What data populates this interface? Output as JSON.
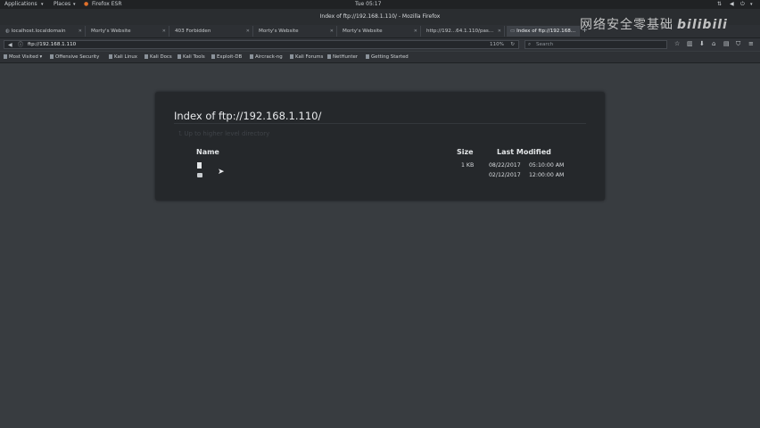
{
  "gnome_bar": {
    "applications": "Applications",
    "places": "Places",
    "firefox": "Firefox ESR",
    "clock": "Tue 05:17"
  },
  "window": {
    "title": "Index of ftp://192.168.1.110/ - Mozilla Firefox"
  },
  "tabs": [
    {
      "label": "localhost.localdomain"
    },
    {
      "label": "Morty's Website"
    },
    {
      "label": "403 Forbidden"
    },
    {
      "label": "Morty's Website"
    },
    {
      "label": "Morty's Website"
    },
    {
      "label": "http://192...64.1.110/pas..."
    },
    {
      "label": "Index of ftp://192.168..."
    }
  ],
  "toolbar": {
    "url": "ftp://192.168.1.110",
    "zoom": "110%",
    "search_placeholder": "Search"
  },
  "bookmarks": [
    {
      "label": "Most Visited"
    },
    {
      "label": "Offensive Security"
    },
    {
      "label": "Kali Linux"
    },
    {
      "label": "Kali Docs"
    },
    {
      "label": "Kali Tools"
    },
    {
      "label": "Exploit-DB"
    },
    {
      "label": "Aircrack-ng"
    },
    {
      "label": "Kali Forums"
    },
    {
      "label": "NetHunter"
    },
    {
      "label": "Getting Started"
    }
  ],
  "watermark": {
    "text": "网络安全零基础",
    "logo": "bilibili"
  },
  "listing": {
    "title": "Index of ftp://192.168.1.110/",
    "parent_link": "Up to higher level directory",
    "columns": {
      "name": "Name",
      "size": "Size",
      "modified": "Last Modified"
    },
    "rows": [
      {
        "icon": "file-icon",
        "size": "1 KB",
        "date": "08/22/2017",
        "time": "05:10:00 AM"
      },
      {
        "icon": "folder-icon",
        "size": "",
        "date": "02/12/2017",
        "time": "12:00:00 AM"
      }
    ]
  },
  "colors": {
    "page_bg": "#383c40",
    "panel_bg": "#25282b",
    "chrome_dark": "#202224"
  }
}
